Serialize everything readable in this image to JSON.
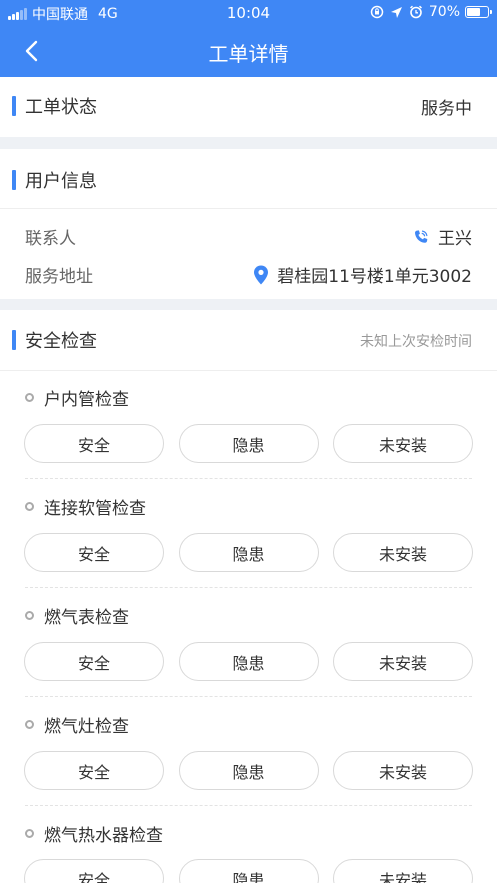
{
  "status_bar": {
    "carrier": "中国联通",
    "network": "4G",
    "time": "10:04",
    "battery_percent": 70,
    "battery_label": "70%"
  },
  "header": {
    "title": "工单详情"
  },
  "order_status": {
    "label": "工单状态",
    "value": "服务中"
  },
  "user_info": {
    "title": "用户信息",
    "contact_label": "联系人",
    "contact_value": "王兴",
    "address_label": "服务地址",
    "address_value": "碧桂园11号楼1单元3002"
  },
  "safety_check": {
    "title": "安全检查",
    "hint": "未知上次安检时间",
    "items": [
      {
        "name": "户内管检查",
        "options": [
          "安全",
          "隐患",
          "未安装"
        ]
      },
      {
        "name": "连接软管检查",
        "options": [
          "安全",
          "隐患",
          "未安装"
        ]
      },
      {
        "name": "燃气表检查",
        "options": [
          "安全",
          "隐患",
          "未安装"
        ]
      },
      {
        "name": "燃气灶检查",
        "options": [
          "安全",
          "隐患",
          "未安装"
        ]
      },
      {
        "name": "燃气热水器检查",
        "options": [
          "安全",
          "隐患",
          "未安装"
        ]
      }
    ]
  },
  "colors": {
    "brand": "#3f87f5",
    "background": "#eef1f5"
  },
  "icons": {
    "back": "chevron-left-icon",
    "phone": "phone-icon",
    "location": "location-pin-icon"
  }
}
